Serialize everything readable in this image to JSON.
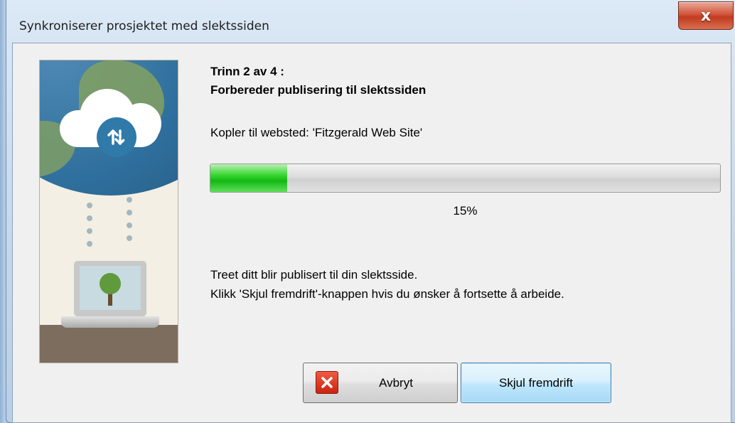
{
  "window": {
    "title": "Synkroniserer prosjektet med slektssiden",
    "close_label": "x"
  },
  "illustration": {
    "icon": "cloud-sync-icon",
    "secondary_icon": "laptop-tree-icon"
  },
  "step": {
    "title": "Trinn 2 av 4 :",
    "subtitle": "Forbereder publisering til slektssiden",
    "connection_text": "Kopler til websted: 'Fitzgerald Web Site'"
  },
  "progress": {
    "value": 15,
    "label": "15%",
    "color": "#1cc41a"
  },
  "info": {
    "line1": "Treet ditt blir publisert til din slektsside.",
    "line2": "Klikk 'Skjul fremdrift'-knappen hvis du ønsker å fortsette å arbeide."
  },
  "buttons": {
    "cancel_label": "Avbryt",
    "cancel_icon": "red-x-icon",
    "hide_label": "Skjul fremdrift"
  },
  "colors": {
    "accent": "#3c7fb1",
    "close_red": "#c13b1f"
  }
}
